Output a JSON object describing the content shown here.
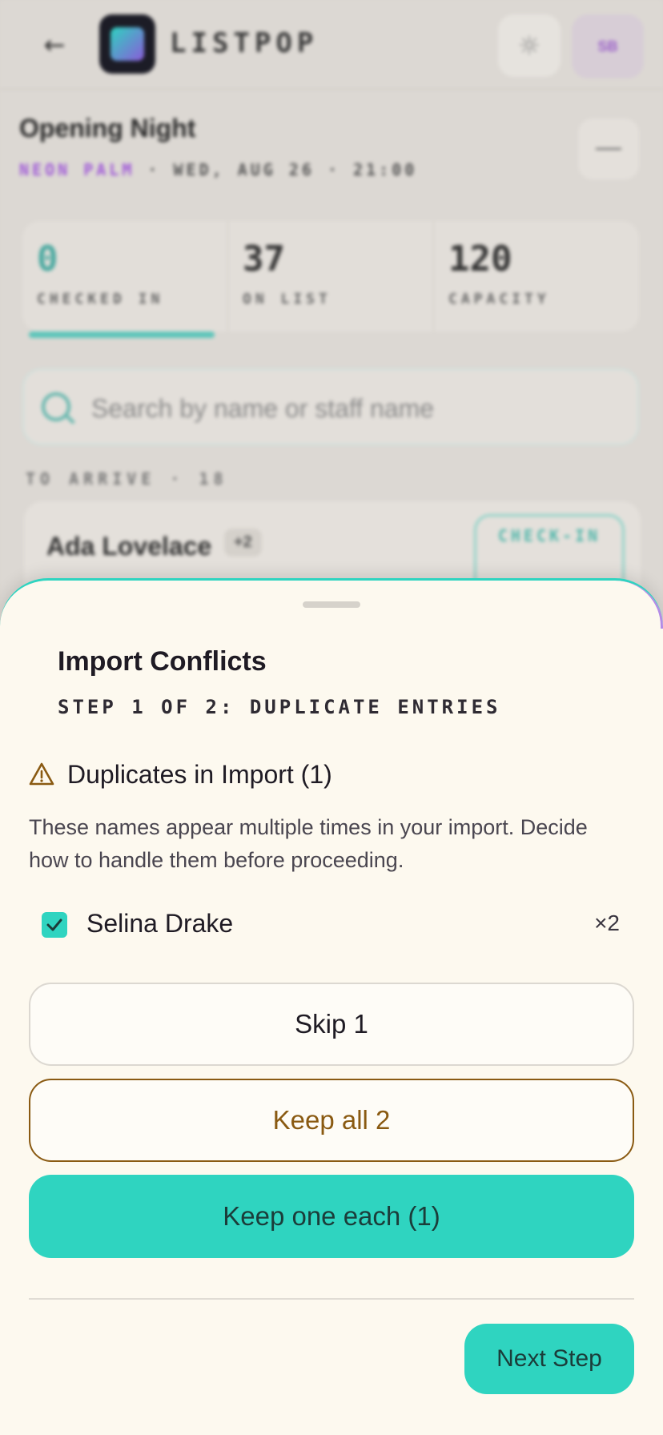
{
  "background": {
    "brand": "LISTPOP",
    "avatar_initials": "SB",
    "event_title": "Opening Night",
    "event_venue": "NEON PALM",
    "event_meta": " · WED, AUG 26 · 21:00",
    "stats": [
      {
        "value": "0",
        "label": "CHECKED IN"
      },
      {
        "value": "37",
        "label": "ON LIST"
      },
      {
        "value": "120",
        "label": "CAPACITY"
      }
    ],
    "search_placeholder": "Search by name or staff name",
    "section_label": "TO ARRIVE · 18",
    "guest": {
      "name": "Ada Lovelace",
      "plus": "+2",
      "checkin_label": "CHECK-IN"
    }
  },
  "sheet": {
    "title": "Import Conflicts",
    "subtitle": "STEP 1 OF 2: DUPLICATE ENTRIES",
    "warning_title": "Duplicates in Import (1)",
    "description": "These names appear multiple times in your import. Decide how to handle them before proceeding.",
    "duplicates": [
      {
        "name": "Selina Drake",
        "count": "×2",
        "checked": true
      }
    ],
    "buttons": {
      "skip": "Skip 1",
      "keep_all": "Keep all 2",
      "keep_one": "Keep one each (1)",
      "next": "Next Step"
    }
  },
  "colors": {
    "accent_teal": "#2fd4c0",
    "warning_brown": "#8a5a12",
    "accent_purple": "#a05ad8"
  }
}
